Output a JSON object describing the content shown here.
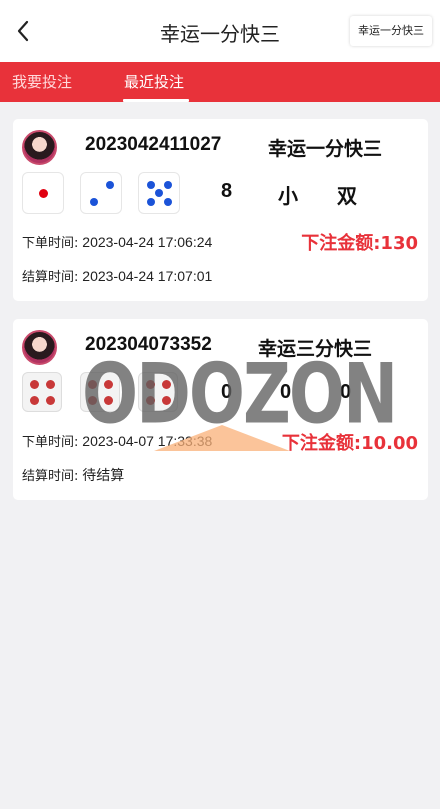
{
  "header": {
    "title": "幸运一分快三",
    "game_pill": "幸运一分快三"
  },
  "tabs": [
    {
      "label": "我要投注",
      "active": false
    },
    {
      "label": "最近投注",
      "active": true
    }
  ],
  "colors": {
    "accent": "#e8323a",
    "background": "#f1f1f3"
  },
  "bets": [
    {
      "order_no": "2023042411027",
      "game": "幸运一分快三",
      "dice": [
        1,
        2,
        5
      ],
      "dice_style": "colored",
      "sum": "8",
      "size": "小",
      "parity": "双",
      "order_time_label": "下单时间:",
      "order_time": "2023-04-24 17:06:24",
      "settle_time_label": "结算时间:",
      "settle_time": "2023-04-24 17:07:01",
      "amount_label": "下注金额:",
      "amount": "130"
    },
    {
      "order_no": "202304073352",
      "game": "幸运三分快三",
      "dice": [
        4,
        4,
        4
      ],
      "dice_style": "pending",
      "sum": "0",
      "size": "0",
      "parity": "0",
      "order_time_label": "下单时间:",
      "order_time": "2023-04-07 17:33:38",
      "settle_time_label": "结算时间:",
      "settle_time": "待结算",
      "amount_label": "下注金额:",
      "amount": "10.00"
    }
  ],
  "watermark": {
    "text": "ODOZON"
  }
}
